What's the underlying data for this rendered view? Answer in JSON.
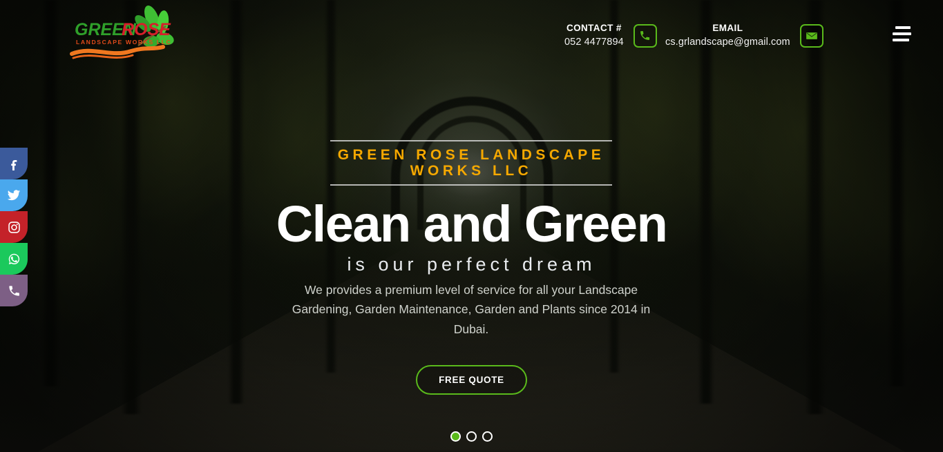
{
  "site": {
    "company_name": "Green Rose Landscape Works LLC",
    "accent_green": "#5aba1b",
    "accent_amber": "#f5a800"
  },
  "logo": {
    "word_one": "GREEN",
    "word_two": "ROSE",
    "tagline": "LANDSCAPE WORKS LLC",
    "word_one_color": "#2fa02a",
    "word_two_color": "#d5202a",
    "tagline_color": "#e04a1a",
    "swoosh_color": "#f07820",
    "leaf_color": "#3fbf34"
  },
  "header": {
    "contact": {
      "label": "CONTACT #",
      "value": "052 4477894",
      "icon": "phone-icon"
    },
    "email": {
      "label": "EMAIL",
      "value": "cs.grlandscape@gmail.com",
      "icon": "envelope-icon"
    },
    "menu_icon": "hamburger-menu-icon"
  },
  "social": [
    {
      "name": "facebook",
      "icon": "facebook-icon",
      "color": "#3b5a9b",
      "glyph": "f"
    },
    {
      "name": "twitter",
      "icon": "twitter-icon",
      "color": "#4aa8ed",
      "glyph": "t"
    },
    {
      "name": "instagram",
      "icon": "instagram-icon",
      "color": "#c42229",
      "glyph": "i"
    },
    {
      "name": "whatsapp",
      "icon": "whatsapp-icon",
      "color": "#1bc95c",
      "glyph": "w"
    },
    {
      "name": "phone",
      "icon": "phone-icon",
      "color": "#7d5f85",
      "glyph": "p"
    }
  ],
  "hero": {
    "eyebrow": "GREEN ROSE LANDSCAPE WORKS LLC",
    "headline": "Clean and Green",
    "subhead": "is our perfect dream",
    "lede": "We provides a premium level of service for all your Landscape Gardening, Garden Maintenance, Garden and Plants since 2014 in Dubai.",
    "cta_label": "FREE QUOTE",
    "slides": [
      {
        "active": true
      },
      {
        "active": false
      },
      {
        "active": false
      }
    ],
    "active_slide": 1,
    "total_slides": 3
  }
}
